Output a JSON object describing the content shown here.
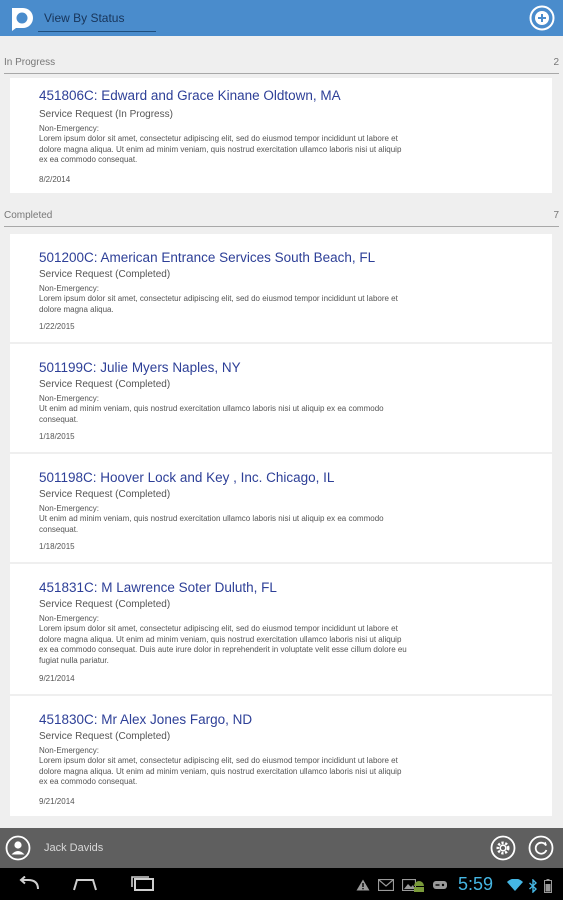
{
  "header": {
    "view_label": "View By Status"
  },
  "sections": [
    {
      "title": "In Progress",
      "count": "2",
      "items": [
        {
          "title": "451806C: Edward  and  Grace Kinane Oldtown, MA",
          "type": "Service Request (In Progress)",
          "category": "Non-Emergency:",
          "desc": [
            "Lorem ipsum dolor sit amet, consectetur adipiscing elit, sed do eiusmod tempor incididunt ut labore et",
            "dolore magna aliqua. Ut enim ad minim veniam, quis nostrud exercitation ullamco laboris nisi ut aliquip",
            "ex ea commodo consequat."
          ],
          "date": "8/2/2014"
        }
      ]
    },
    {
      "title": "Completed",
      "count": "7",
      "items": [
        {
          "title": "501200C:  American Entrance Services South Beach, FL",
          "type": "Service Request (Completed)",
          "category": "Non-Emergency:",
          "desc": [
            "Lorem ipsum dolor sit amet, consectetur adipiscing elit, sed do eiusmod tempor incididunt ut labore et",
            "dolore magna aliqua."
          ],
          "date": "1/22/2015"
        },
        {
          "title": "501199C: Julie Myers Naples, NY",
          "type": "Service Request (Completed)",
          "category": "Non-Emergency:",
          "desc": [
            "Ut enim ad minim veniam, quis nostrud exercitation ullamco laboris nisi ut aliquip ex ea commodo",
            "consequat."
          ],
          "date": "1/18/2015"
        },
        {
          "title": "501198C:  Hoover Lock  and  Key , Inc. Chicago, IL",
          "type": "Service Request (Completed)",
          "category": "Non-Emergency:",
          "desc": [
            "Ut enim ad minim veniam, quis nostrud exercitation ullamco laboris nisi ut aliquip ex ea commodo",
            "consequat."
          ],
          "date": "1/18/2015"
        },
        {
          "title": "451831C: M Lawrence Soter Duluth, FL",
          "type": "Service Request (Completed)",
          "category": "Non-Emergency:",
          "desc": [
            "Lorem ipsum dolor sit amet, consectetur adipiscing elit, sed do eiusmod tempor incididunt ut labore et",
            "dolore magna aliqua. Ut enim ad minim veniam, quis nostrud exercitation ullamco laboris nisi ut aliquip",
            "ex ea commodo consequat. Duis aute irure dolor in reprehenderit in voluptate velit esse cillum dolore eu",
            "fugiat nulla pariatur."
          ],
          "date": "9/21/2014"
        },
        {
          "title": "451830C: Mr Alex Jones Fargo, ND",
          "type": "Service Request (Completed)",
          "category": "Non-Emergency:",
          "desc": [
            "Lorem ipsum dolor sit amet, consectetur adipiscing elit, sed do eiusmod tempor incididunt ut labore et",
            "dolore magna aliqua. Ut enim ad minim veniam, quis nostrud exercitation ullamco laboris nisi ut aliquip",
            "ex ea commodo consequat."
          ],
          "date": "9/21/2014"
        }
      ]
    }
  ],
  "footer": {
    "user_name": "Jack Davids"
  },
  "system_bar": {
    "time": "5:59"
  },
  "icons": {
    "logo": "app-logo-icon",
    "add": "add-circle-icon",
    "avatar": "user-avatar-icon",
    "settings": "gear-icon",
    "refresh": "refresh-icon"
  },
  "colors": {
    "top_bar": "#4a8ccc",
    "title_link": "#2d3f97",
    "bottom_bar": "#5f5f5f",
    "clock": "#45b6e3"
  }
}
